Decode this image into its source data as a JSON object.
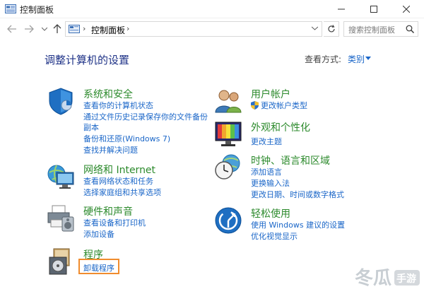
{
  "window": {
    "title": "控制面板",
    "minimize_label": "—",
    "maximize_label": "☐",
    "close_label": "✕"
  },
  "nav": {
    "back_icon": "back-arrow-icon",
    "forward_icon": "forward-arrow-icon",
    "recent_icon": "chevron-down-icon",
    "up_icon": "up-arrow-icon",
    "breadcrumb": "控制面板",
    "search_placeholder": "搜索控制面板"
  },
  "main": {
    "heading": "调整计算机的设置",
    "view_by_label": "查看方式:",
    "view_by_value": "类别"
  },
  "categories": {
    "system": {
      "title": "系统和安全",
      "links": [
        "查看你的计算机状态",
        "通过文件历史记录保存你的文件备份",
        "副本",
        "备份和还原(Windows 7)",
        "查找并解决问题"
      ]
    },
    "network": {
      "title": "网络和 Internet",
      "links": [
        "查看网络状态和任务",
        "选择家庭组和共享选项"
      ]
    },
    "hardware": {
      "title": "硬件和声音",
      "links": [
        "查看设备和打印机",
        "添加设备"
      ]
    },
    "programs": {
      "title": "程序",
      "links": [
        "卸载程序"
      ]
    },
    "users": {
      "title": "用户帐户",
      "links": [
        "更改帐户类型"
      ]
    },
    "appearance": {
      "title": "外观和个性化",
      "links": [
        "更改主题"
      ]
    },
    "clock": {
      "title": "时钟、语言和区域",
      "links": [
        "添加语言",
        "更换输入法",
        "更改日期、时间或数字格式"
      ]
    },
    "ease": {
      "title": "轻松使用",
      "links": [
        "使用 Windows 建议的设置",
        "优化视觉显示"
      ]
    }
  },
  "watermark": {
    "text": "冬瓜",
    "sub": "手游"
  },
  "colors": {
    "link": "#1a66c8",
    "category_title": "#2c8a2c",
    "heading": "#1e3287",
    "highlight": "#f08c2e"
  }
}
